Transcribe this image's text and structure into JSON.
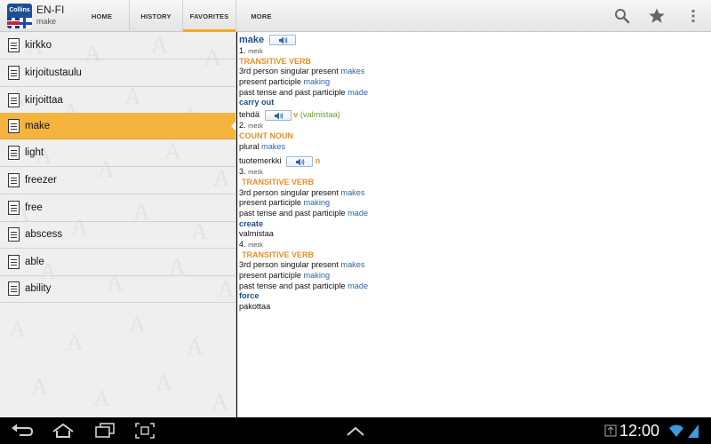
{
  "app": {
    "logo_text": "Collins",
    "title": "EN-FI",
    "subtitle": "make"
  },
  "tabs": [
    {
      "label": "HOME",
      "active": false
    },
    {
      "label": "HISTORY",
      "active": false
    },
    {
      "label": "FAVORITES",
      "active": true
    },
    {
      "label": "MORE",
      "active": false
    }
  ],
  "actions": {
    "search_icon": "search-icon",
    "favorite_icon": "star-icon",
    "overflow_icon": "overflow-menu-icon"
  },
  "list": {
    "items": [
      {
        "label": "kirkko",
        "selected": false
      },
      {
        "label": "kirjoitustaulu",
        "selected": false
      },
      {
        "label": "kirjoittaa",
        "selected": false
      },
      {
        "label": "make",
        "selected": true
      },
      {
        "label": "light",
        "selected": false
      },
      {
        "label": "freezer",
        "selected": false
      },
      {
        "label": "free",
        "selected": false
      },
      {
        "label": "abscess",
        "selected": false
      },
      {
        "label": "able",
        "selected": false
      },
      {
        "label": "ability",
        "selected": false
      }
    ]
  },
  "entry": {
    "headword": "make",
    "sense1": {
      "number": "1.",
      "pron": "meɪk",
      "pos": "TRANSITIVE VERB",
      "forms": [
        {
          "label": "3rd person singular present",
          "value": "makes"
        },
        {
          "label": "present participle",
          "value": "making"
        },
        {
          "label": "past tense and past participle",
          "value": "made"
        }
      ],
      "phrase": "carry out",
      "translation": "tehdä",
      "trans_pos": "v",
      "trans_note": "(valmistaa)"
    },
    "sense2": {
      "number": "2.",
      "pron": "meɪk",
      "pos": "COUNT NOUN",
      "plural_label": "plural",
      "plural_value": "makes",
      "translation": "tuotemerkki",
      "trans_pos": "n"
    },
    "sense3": {
      "number": "3.",
      "pron": "meɪk",
      "pos": "TRANSITIVE VERB",
      "forms": [
        {
          "label": "3rd person singular present",
          "value": "makes"
        },
        {
          "label": "present participle",
          "value": "making"
        },
        {
          "label": "past tense and past participle",
          "value": "made"
        }
      ],
      "phrase": "create",
      "translation": "valmistaa"
    },
    "sense4": {
      "number": "4.",
      "pron": "meɪk",
      "pos": "TRANSITIVE VERB",
      "forms": [
        {
          "label": "3rd person singular present",
          "value": "makes"
        },
        {
          "label": "present participle",
          "value": "making"
        },
        {
          "label": "past tense and past participle",
          "value": "made"
        }
      ],
      "phrase": "force",
      "translation": "pakottaa"
    }
  },
  "system": {
    "time": "12:00",
    "icons": [
      "back-icon",
      "home-icon",
      "recent-apps-icon",
      "screenshot-icon",
      "up-chevron-icon",
      "usb-icon",
      "wifi-icon",
      "battery-icon"
    ]
  },
  "colors": {
    "accent": "#f6b43f",
    "link": "#2e63a8",
    "pos": "#e8902d",
    "headword": "#1a4f8f"
  }
}
